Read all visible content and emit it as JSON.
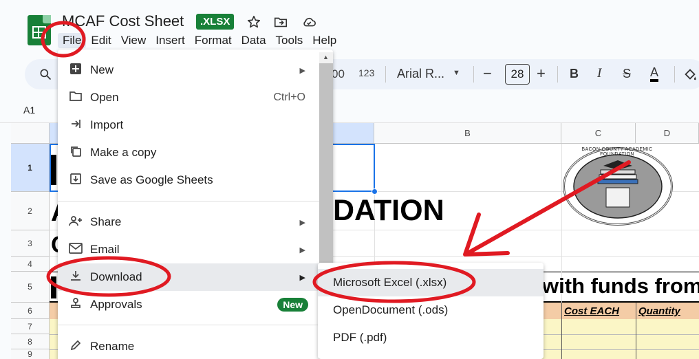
{
  "document": {
    "title": "MCAF Cost Sheet",
    "format_badge": ".XLSX"
  },
  "menubar": [
    "File",
    "Edit",
    "View",
    "Insert",
    "Format",
    "Data",
    "Tools",
    "Help"
  ],
  "toolbar": {
    "number_format": "123",
    "font_name": "Arial R...",
    "font_size": "28",
    "bold": "B",
    "italic": "I",
    "strike": "S",
    "text_color": "A"
  },
  "name_box": "A1",
  "columns": [
    "B",
    "C",
    "D"
  ],
  "rows": [
    "1",
    "2",
    "3",
    "4",
    "5",
    "6",
    "7",
    "8",
    "9"
  ],
  "cells": {
    "b2_fragment": "DATION",
    "a2_fragment": "A",
    "a3_fragment": "C",
    "row5_fragment": "with funds from",
    "cost_each": "Cost EACH",
    "quantity": "Quantity",
    "seal_text": "BACON COUNTY ACADEMIC FOUNDATION"
  },
  "file_menu": {
    "items": [
      {
        "icon": "plus-box-icon",
        "label": "New",
        "shortcut": "",
        "submenu": true
      },
      {
        "icon": "folder-icon",
        "label": "Open",
        "shortcut": "Ctrl+O",
        "submenu": false
      },
      {
        "icon": "import-icon",
        "label": "Import",
        "shortcut": "",
        "submenu": false
      },
      {
        "icon": "copy-icon",
        "label": "Make a copy",
        "shortcut": "",
        "submenu": false
      },
      {
        "icon": "save-sheets-icon",
        "label": "Save as Google Sheets",
        "shortcut": "",
        "submenu": false
      },
      {
        "icon": "share-icon",
        "label": "Share",
        "shortcut": "",
        "submenu": true
      },
      {
        "icon": "email-icon",
        "label": "Email",
        "shortcut": "",
        "submenu": true
      },
      {
        "icon": "download-icon",
        "label": "Download",
        "shortcut": "",
        "submenu": true
      },
      {
        "icon": "approvals-icon",
        "label": "Approvals",
        "shortcut": "",
        "submenu": false
      },
      {
        "icon": "pencil-icon",
        "label": "Rename",
        "shortcut": "",
        "submenu": false
      }
    ],
    "new_badge": "New"
  },
  "download_submenu": [
    "Microsoft Excel (.xlsx)",
    "OpenDocument (.ods)",
    "PDF (.pdf)"
  ],
  "colors": {
    "brand_green": "#188038",
    "annotation_red": "#e01a22",
    "toolbar_bg": "#edf2fa",
    "header_orange": "#f4cca6",
    "row_yellow": "#fbf6c6"
  }
}
